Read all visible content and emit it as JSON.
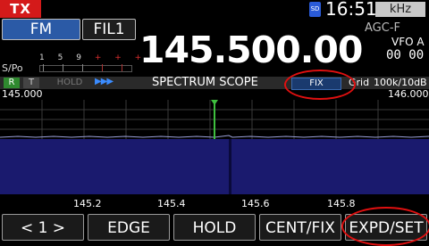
{
  "status": {
    "tx": "TX",
    "sd": "SD",
    "clock": "16:51",
    "unit_button": "kHz",
    "agc": "AGC-F"
  },
  "mode": {
    "mode_label": "FM",
    "filter_label": "FIL1"
  },
  "meter": {
    "label": "S/Po",
    "scale": [
      "1",
      "5",
      "9"
    ],
    "scale_over": [
      "+",
      "+",
      "+"
    ]
  },
  "frequency": {
    "display": "145.500.00",
    "vfo_label": "VFO A",
    "vfo_sub": "00 00"
  },
  "scope_header": {
    "r_label": "R",
    "t_label": "T",
    "hold_label": "HOLD",
    "speed": "▶▶▶",
    "title": "SPECTRUM SCOPE",
    "mode_badge": "FIX",
    "grid_label": "Grid",
    "grid_value": "100k/10dB"
  },
  "scope": {
    "edge_low": "145.000",
    "edge_high": "146.000",
    "axis_ticks": [
      "145.2",
      "145.4",
      "145.6",
      "145.8"
    ],
    "accent_color": "#3fbf3f",
    "waterfall_color": "#1a1a6e"
  },
  "function_buttons": [
    {
      "label": "< 1 >"
    },
    {
      "label": "EDGE"
    },
    {
      "label": "HOLD"
    },
    {
      "label": "CENT/FIX"
    },
    {
      "label": "EXPD/SET"
    }
  ]
}
